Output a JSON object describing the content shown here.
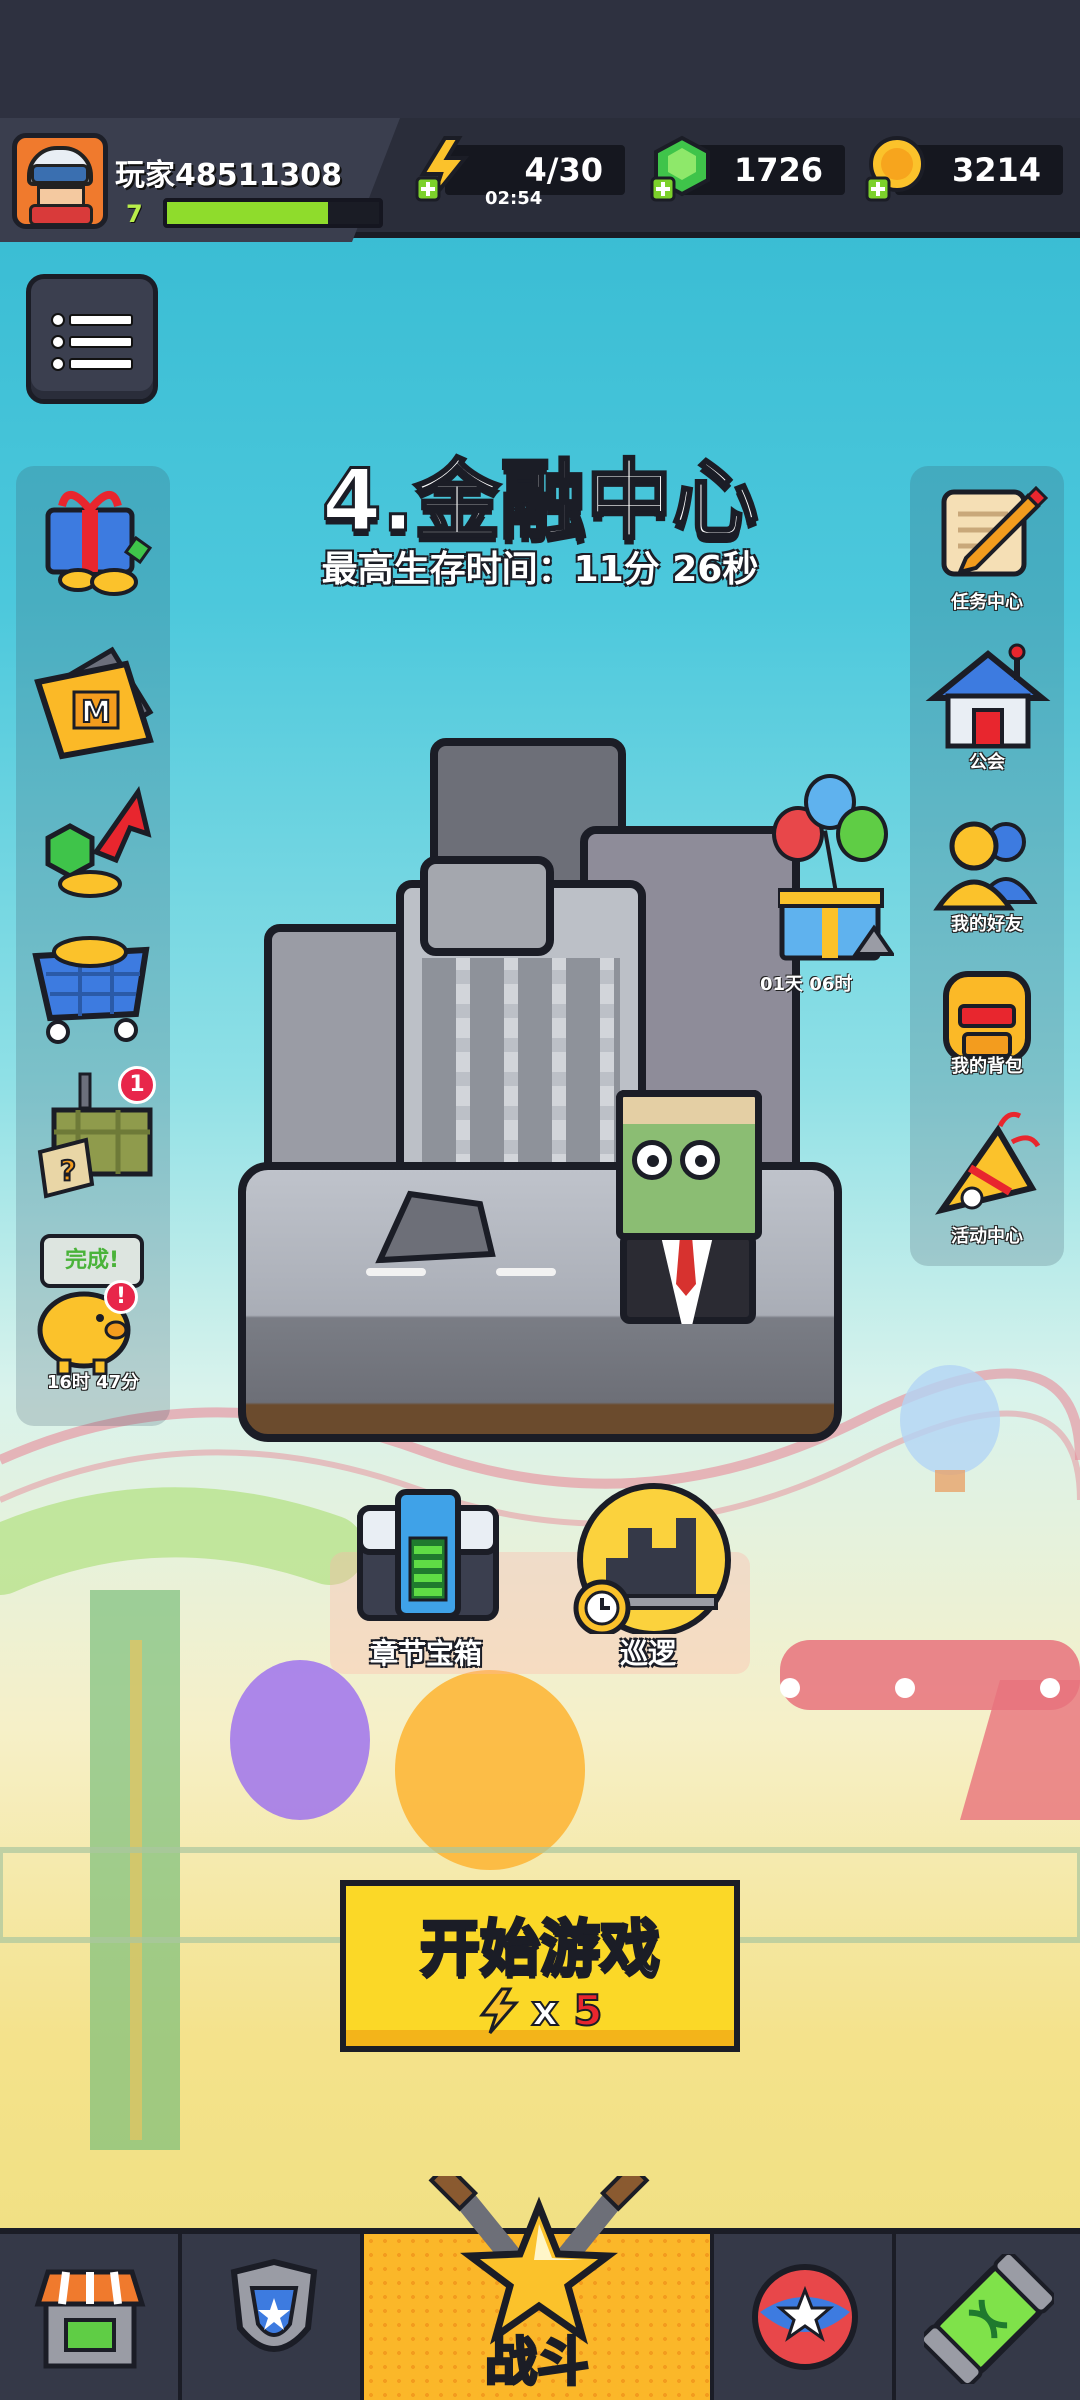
{
  "player": {
    "name": "玩家48511308",
    "level": "7",
    "xp_fraction": 0.76
  },
  "resources": {
    "energy": {
      "value": "4/30",
      "timer": "02:54",
      "icon": "lightning-plus-icon"
    },
    "gems": {
      "value": "1726",
      "icon": "green-gem-plus-icon"
    },
    "coins": {
      "value": "3214",
      "icon": "gold-coin-plus-icon"
    }
  },
  "stage": {
    "title": "4.金融中心",
    "survival_time": "最高生存时间：11分 26秒"
  },
  "left_panel": {
    "items": [
      {
        "name": "gift-bundle-icon"
      },
      {
        "name": "m-card-icon"
      },
      {
        "name": "gem-upgrade-icon"
      },
      {
        "name": "shop-cart-icon"
      },
      {
        "name": "mystery-crate-icon",
        "badge": "1"
      },
      {
        "name": "piggy-bank-icon",
        "bubble": "完成!",
        "timer": "16时 47分"
      }
    ]
  },
  "right_panel": {
    "items": [
      {
        "label": "任务中心",
        "icon": "quest-scroll-icon"
      },
      {
        "label": "公会",
        "icon": "guild-house-icon"
      },
      {
        "label": "我的好友",
        "icon": "friends-icon"
      },
      {
        "label": "我的背包",
        "icon": "backpack-icon"
      },
      {
        "label": "活动中心",
        "icon": "party-horn-icon"
      }
    ]
  },
  "gift": {
    "timer": "01天 06时"
  },
  "actions": {
    "chest_label": "章节宝箱",
    "patrol_label": "巡逻"
  },
  "start": {
    "label": "开始游戏",
    "cost_x": "x",
    "cost_n": "5"
  },
  "nav": {
    "tabs": [
      {
        "name": "shop",
        "icon": "shop-stall-icon"
      },
      {
        "name": "equipment",
        "icon": "armor-badge-icon"
      },
      {
        "name": "battle",
        "icon": "star-swords-icon",
        "label": "战斗",
        "active": true
      },
      {
        "name": "talents",
        "icon": "star-orb-icon"
      },
      {
        "name": "evolve",
        "icon": "dna-capsule-icon"
      }
    ]
  },
  "colors": {
    "accent_yellow": "#fbd827",
    "xp_green": "#8fdc2c",
    "badge_red": "#e8264a"
  }
}
